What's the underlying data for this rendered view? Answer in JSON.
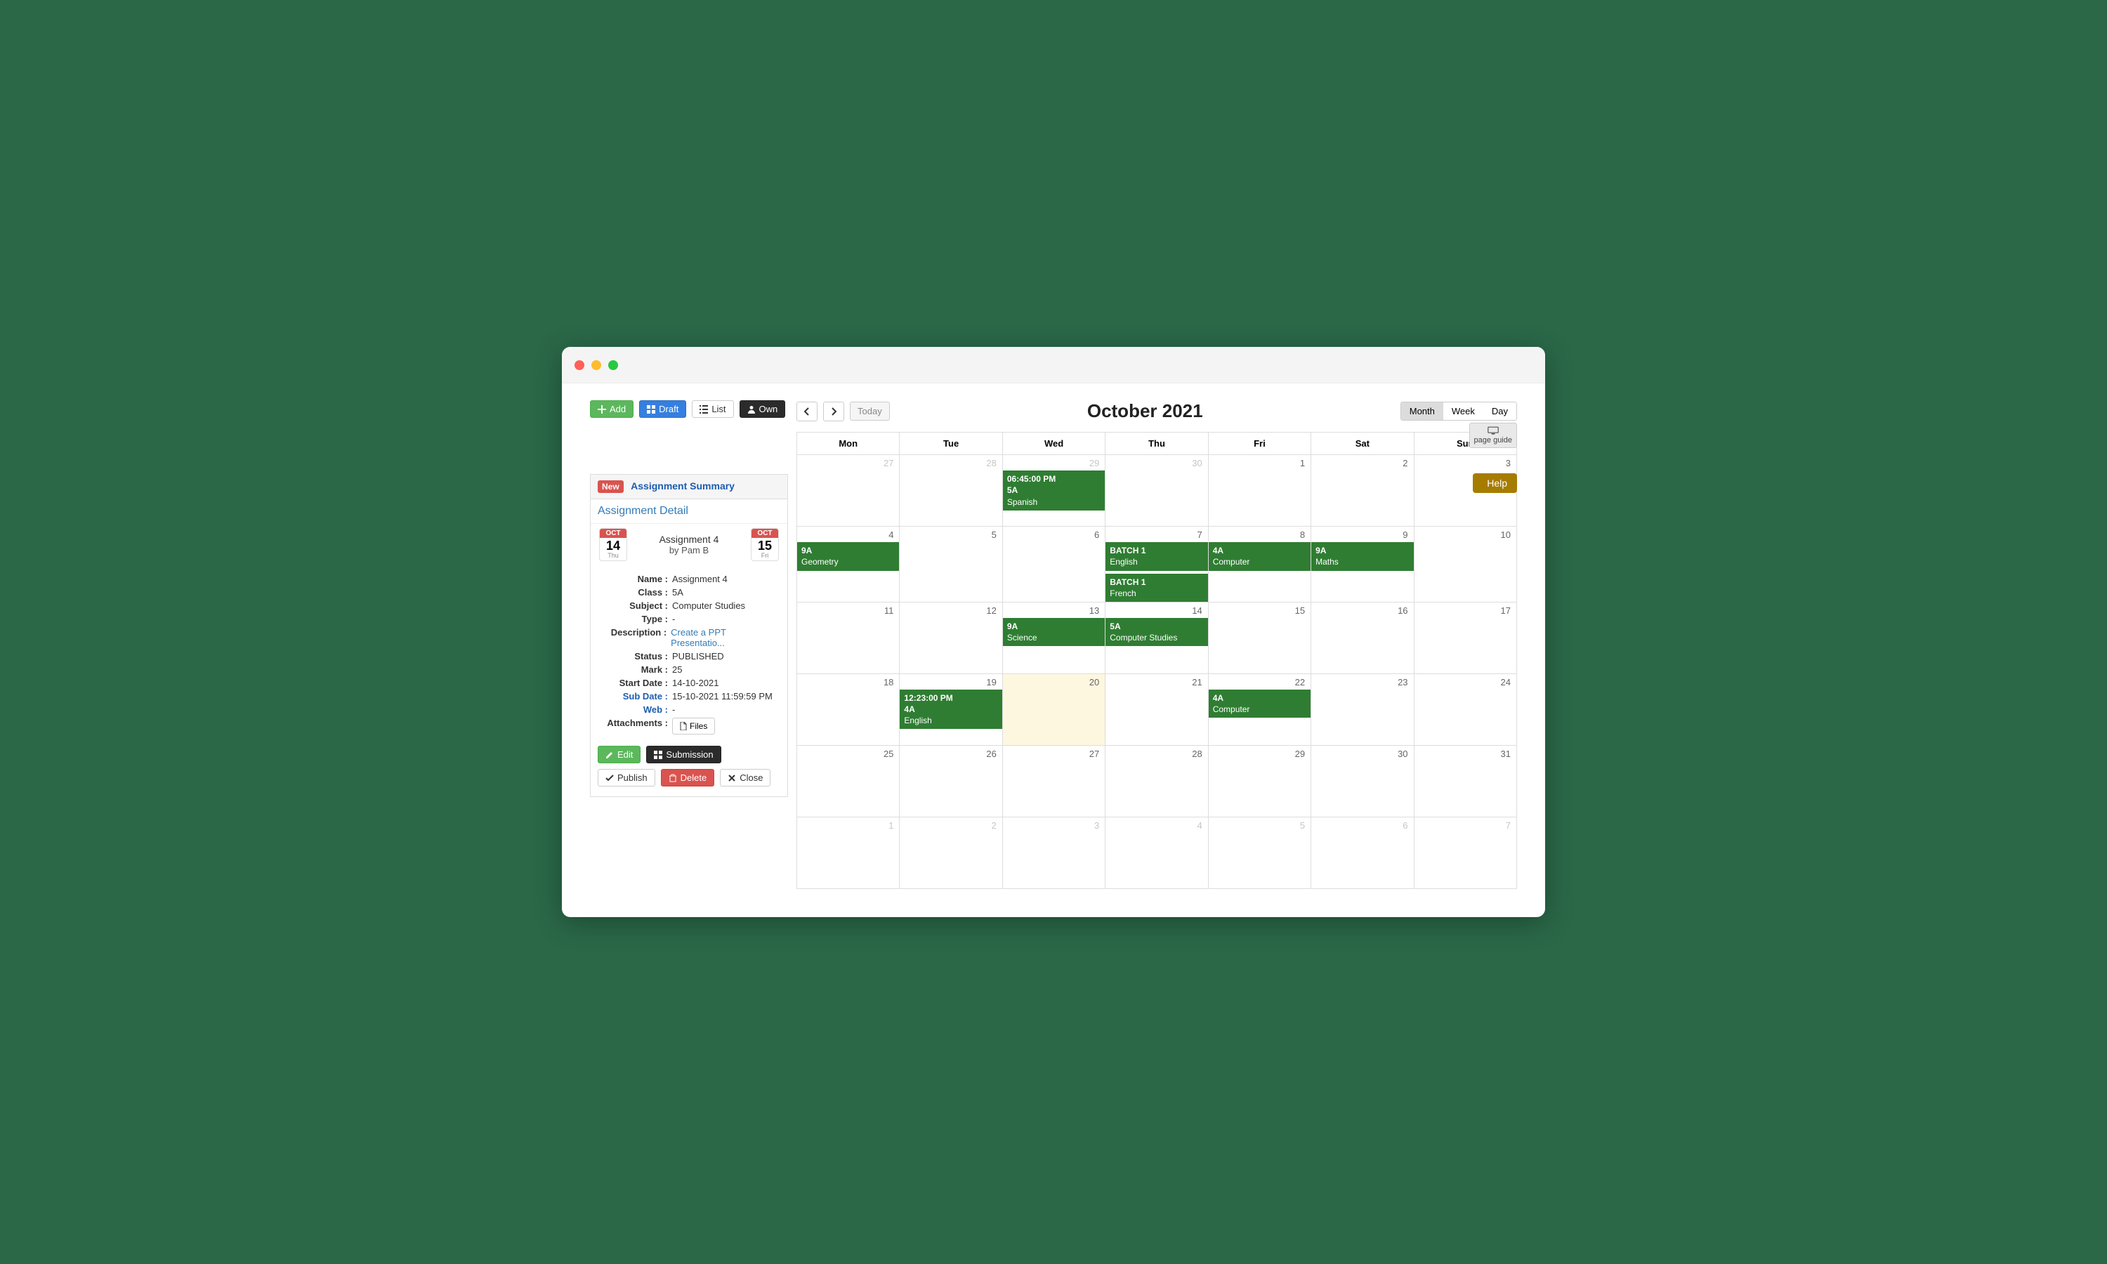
{
  "toolbar": {
    "add_label": "Add",
    "draft_label": "Draft",
    "list_label": "List",
    "own_label": "Own"
  },
  "summary": {
    "new_badge": "New",
    "header": "Assignment Summary",
    "detail_header": "Assignment Detail",
    "start_chip": {
      "month": "OCT",
      "day": "14",
      "weekday": "Thu"
    },
    "end_chip": {
      "month": "OCT",
      "day": "15",
      "weekday": "Fri"
    },
    "assign_title": "Assignment 4",
    "assign_by": "by Pam B",
    "fields": {
      "name_label": "Name :",
      "name_value": "Assignment 4",
      "class_label": "Class :",
      "class_value": "5A",
      "subject_label": "Subject :",
      "subject_value": "Computer Studies",
      "type_label": "Type :",
      "type_value": "-",
      "desc_label": "Description :",
      "desc_value": "Create a PPT Presentatio...",
      "status_label": "Status :",
      "status_value": "PUBLISHED",
      "mark_label": "Mark :",
      "mark_value": "25",
      "start_label": "Start Date :",
      "start_value": "14-10-2021",
      "sub_label": "Sub Date :",
      "sub_value": "15-10-2021 11:59:59 PM",
      "web_label": "Web :",
      "web_value": "-",
      "attach_label": "Attachments :",
      "attach_btn": "Files"
    },
    "actions": {
      "edit": "Edit",
      "submission": "Submission",
      "publish": "Publish",
      "delete": "Delete",
      "close": "Close"
    }
  },
  "calendar": {
    "title": "October 2021",
    "today_label": "Today",
    "views": {
      "month": "Month",
      "week": "Week",
      "day": "Day"
    },
    "page_guide": "page guide",
    "help": "Help",
    "weekdays": [
      "Mon",
      "Tue",
      "Wed",
      "Thu",
      "Fri",
      "Sat",
      "Sun"
    ],
    "weeks": [
      [
        {
          "n": "27",
          "other": true,
          "events": []
        },
        {
          "n": "28",
          "other": true,
          "events": []
        },
        {
          "n": "29",
          "other": true,
          "events": [
            {
              "time": "06:45:00 PM",
              "batch": "5A",
              "subject": "Spanish"
            }
          ]
        },
        {
          "n": "30",
          "other": true,
          "events": []
        },
        {
          "n": "1",
          "events": []
        },
        {
          "n": "2",
          "events": []
        },
        {
          "n": "3",
          "events": []
        }
      ],
      [
        {
          "n": "4",
          "events": [
            {
              "batch": "9A",
              "subject": "Geometry"
            }
          ]
        },
        {
          "n": "5",
          "events": []
        },
        {
          "n": "6",
          "events": []
        },
        {
          "n": "7",
          "events": [
            {
              "batch": "BATCH 1",
              "subject": "English"
            },
            {
              "batch": "BATCH 1",
              "subject": "French"
            }
          ]
        },
        {
          "n": "8",
          "events": [
            {
              "batch": "4A",
              "subject": "Computer"
            }
          ]
        },
        {
          "n": "9",
          "events": [
            {
              "batch": "9A",
              "subject": "Maths"
            }
          ]
        },
        {
          "n": "10",
          "events": []
        }
      ],
      [
        {
          "n": "11",
          "events": []
        },
        {
          "n": "12",
          "events": []
        },
        {
          "n": "13",
          "events": [
            {
              "batch": "9A",
              "subject": "Science"
            }
          ]
        },
        {
          "n": "14",
          "events": [
            {
              "batch": "5A",
              "subject": "Computer Studies"
            }
          ]
        },
        {
          "n": "15",
          "events": []
        },
        {
          "n": "16",
          "events": []
        },
        {
          "n": "17",
          "events": []
        }
      ],
      [
        {
          "n": "18",
          "events": []
        },
        {
          "n": "19",
          "events": [
            {
              "time": "12:23:00 PM",
              "batch": "4A",
              "subject": "English"
            }
          ]
        },
        {
          "n": "20",
          "today": true,
          "events": []
        },
        {
          "n": "21",
          "events": []
        },
        {
          "n": "22",
          "events": [
            {
              "batch": "4A",
              "subject": "Computer"
            }
          ]
        },
        {
          "n": "23",
          "events": []
        },
        {
          "n": "24",
          "events": []
        }
      ],
      [
        {
          "n": "25",
          "events": []
        },
        {
          "n": "26",
          "events": []
        },
        {
          "n": "27",
          "events": []
        },
        {
          "n": "28",
          "events": []
        },
        {
          "n": "29",
          "events": []
        },
        {
          "n": "30",
          "events": []
        },
        {
          "n": "31",
          "events": []
        }
      ],
      [
        {
          "n": "1",
          "other": true,
          "events": []
        },
        {
          "n": "2",
          "other": true,
          "events": []
        },
        {
          "n": "3",
          "other": true,
          "events": []
        },
        {
          "n": "4",
          "other": true,
          "events": []
        },
        {
          "n": "5",
          "other": true,
          "events": []
        },
        {
          "n": "6",
          "other": true,
          "events": []
        },
        {
          "n": "7",
          "other": true,
          "events": []
        }
      ]
    ]
  }
}
